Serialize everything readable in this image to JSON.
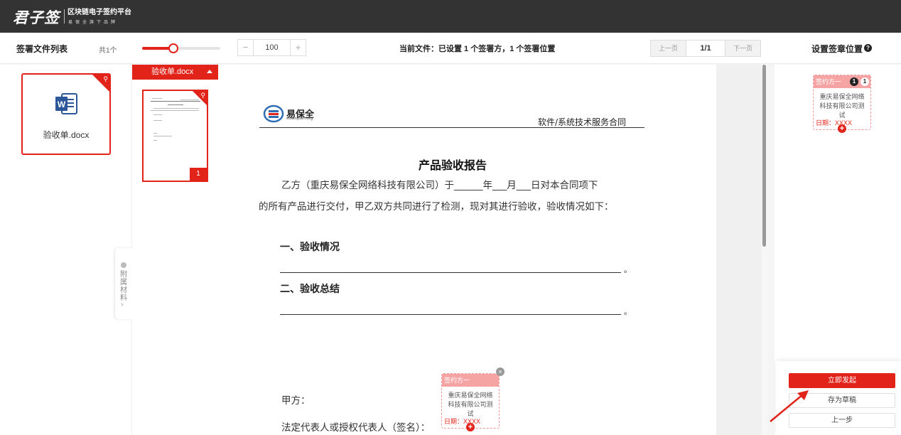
{
  "brand": {
    "logo": "君子签",
    "tagline": "区块链电子签约平台",
    "subtitle": "易保全旗下品牌"
  },
  "toolbar": {
    "file_list_title": "签署文件列表",
    "file_count": "共1个",
    "zoom_level": 40,
    "zoom_value": "100",
    "zoom_minus": "−",
    "zoom_plus": "+",
    "current_file_status": "当前文件：已设置 1 个签署方，1 个签署位置",
    "prev_page": "上一页",
    "page_indicator": "1/1",
    "next_page": "下一页",
    "set_position_title": "设置签章位置"
  },
  "file_card": {
    "name": "验收单.docx",
    "icon": "word-icon"
  },
  "attachments": {
    "label": "附属材料",
    "arrow": "›"
  },
  "thumbnails": {
    "header": "验收单.docx",
    "page_number": "1"
  },
  "document": {
    "logo_name": "易保全",
    "logo_url": "ebaoquan.org",
    "header_title": "软件/系统技术服务合同",
    "title": "产品验收报告",
    "paragraph_1": "乙方（重庆易保全网络科技有限公司）于______年___月___日对本合同项下",
    "paragraph_2": "的所有产品进行交付，甲乙双方共同进行了检测，现对其进行验收，验收情况如下：",
    "heading_1": "一、验收情况",
    "heading_2": "二、验收总结",
    "line_end": "。",
    "party_a": "甲方：",
    "legal_rep": "法定代表人或授权代表人（签名）："
  },
  "signature": {
    "label": "签约方一",
    "company": "重庆易保全网络科技有限公司测试",
    "date": "日期：XXXX",
    "close": "×",
    "plus": "+",
    "badge_a": "1",
    "badge_b": "1"
  },
  "actions": {
    "start": "立即发起",
    "draft": "存为草稿",
    "prev": "上一步"
  },
  "colors": {
    "accent": "#e2231a",
    "topbar": "#333333",
    "sig_header": "#f6a3a3"
  }
}
